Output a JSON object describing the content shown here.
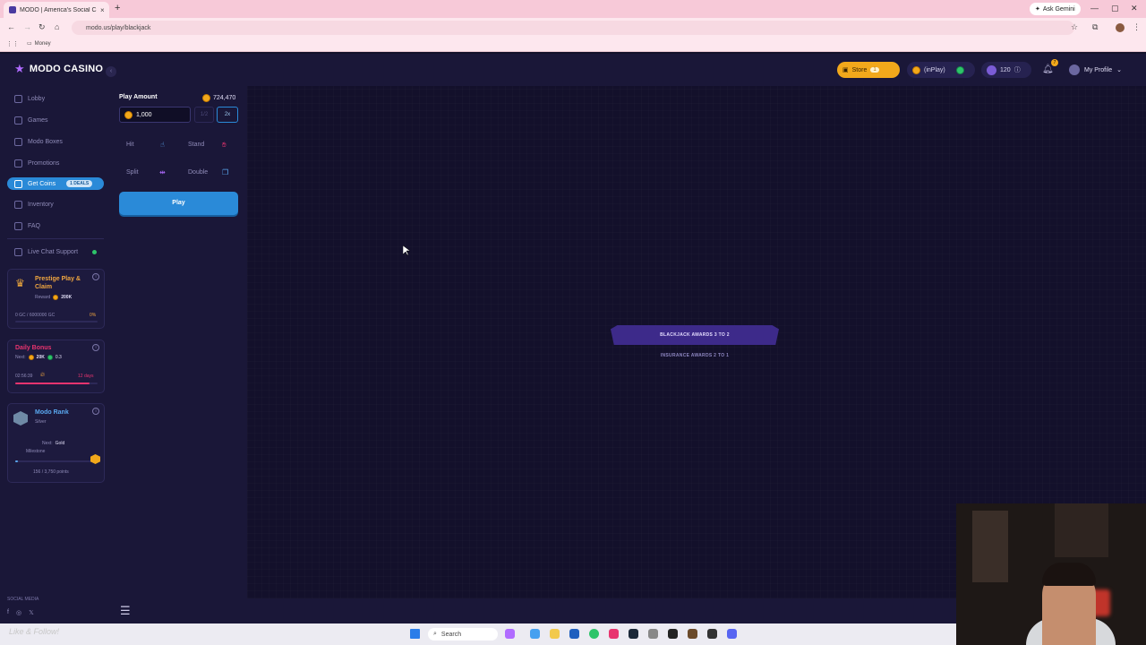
{
  "browser": {
    "tab_title": "MODO | America's Social Casi...",
    "tab_close": "×",
    "new_tab": "+",
    "ask_gemini": "Ask Gemini",
    "url": "modo.us/play/blackjack",
    "bookmark": "Money"
  },
  "header": {
    "logo": "MODO CASINO",
    "store_label": "Store",
    "store_badge": "1",
    "inplay_label": "(inPlay)",
    "rank_value": "120",
    "bell_badge": "7",
    "profile_label": "My Profile"
  },
  "sidebar": {
    "items": [
      {
        "label": "Lobby"
      },
      {
        "label": "Games"
      },
      {
        "label": "Modo Boxes"
      },
      {
        "label": "Promotions"
      },
      {
        "label": "Get Coins",
        "badge": "1 DEALS"
      },
      {
        "label": "Inventory"
      },
      {
        "label": "FAQ"
      },
      {
        "label": "Live Chat Support"
      }
    ],
    "prestige": {
      "title": "Prestige Play & Claim",
      "reward_label": "Reward",
      "reward_value": "200K",
      "progress_text": "0 GC / 6000000 GC",
      "progress_pct_text": "0%",
      "progress": 0
    },
    "daily": {
      "title": "Daily Bonus",
      "next_label": "Next:",
      "next_coins": "20K",
      "next_gems": "0.3",
      "timer": "02:56:39",
      "days": "12 days",
      "progress": 0.9
    },
    "rank": {
      "title": "Modo Rank",
      "tier": "Silver",
      "next_label": "Next:",
      "next_tier": "Gold",
      "milestone": "Milestone",
      "points": "156 / 3,750 points",
      "progress": 0.04
    },
    "social_media": "SOCIAL MEDIA"
  },
  "controls": {
    "play_amount_label": "Play Amount",
    "balance": "724,470",
    "amount_value": "1,000",
    "half_label": "1/2",
    "double_label": "2x",
    "hit": "Hit",
    "stand": "Stand",
    "split": "Split",
    "double": "Double",
    "play": "Play"
  },
  "table": {
    "banner": "BLACKJACK AWARDS 3 TO 2",
    "insurance": "INSURANCE AWARDS 2 TO 1"
  },
  "taskbar": {
    "search": "Search",
    "overlay_text": "Like & Follow!"
  },
  "colors": {
    "accent": "#2a8ad8",
    "store": "#f2a81b",
    "background": "#13112a"
  }
}
